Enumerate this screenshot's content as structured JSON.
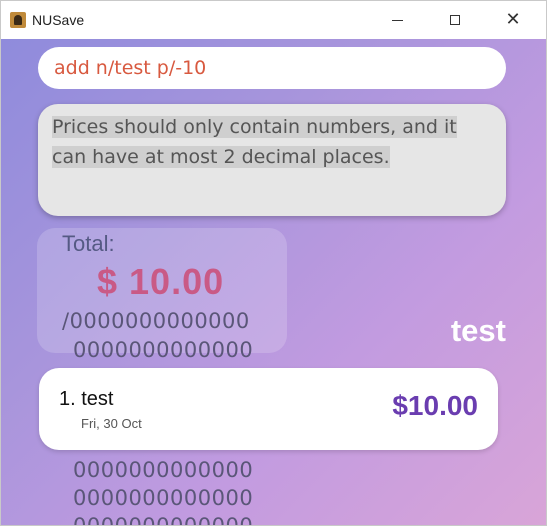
{
  "window": {
    "title": "NUSave",
    "minimize_glyph": "",
    "maximize_glyph": "",
    "close_glyph": "✕"
  },
  "command_box": {
    "value": "add n/test p/-10"
  },
  "result_display": {
    "text": "Prices should only contain numbers, and it can have at most 2 decimal places."
  },
  "budget": {
    "total_label": "Total:",
    "total_amount": "$ 10.00",
    "threshold_line_1": "/0000000000000",
    "threshold_line_2": "0000000000000",
    "threshold_line_3": "0000000000000",
    "threshold_line_4": "0000000000000",
    "threshold_line_5": "0000000000000"
  },
  "budget_name": "test",
  "expenditures": [
    {
      "index_name": "1. test",
      "date": "Fri, 30 Oct",
      "price": "$10.00"
    }
  ]
}
